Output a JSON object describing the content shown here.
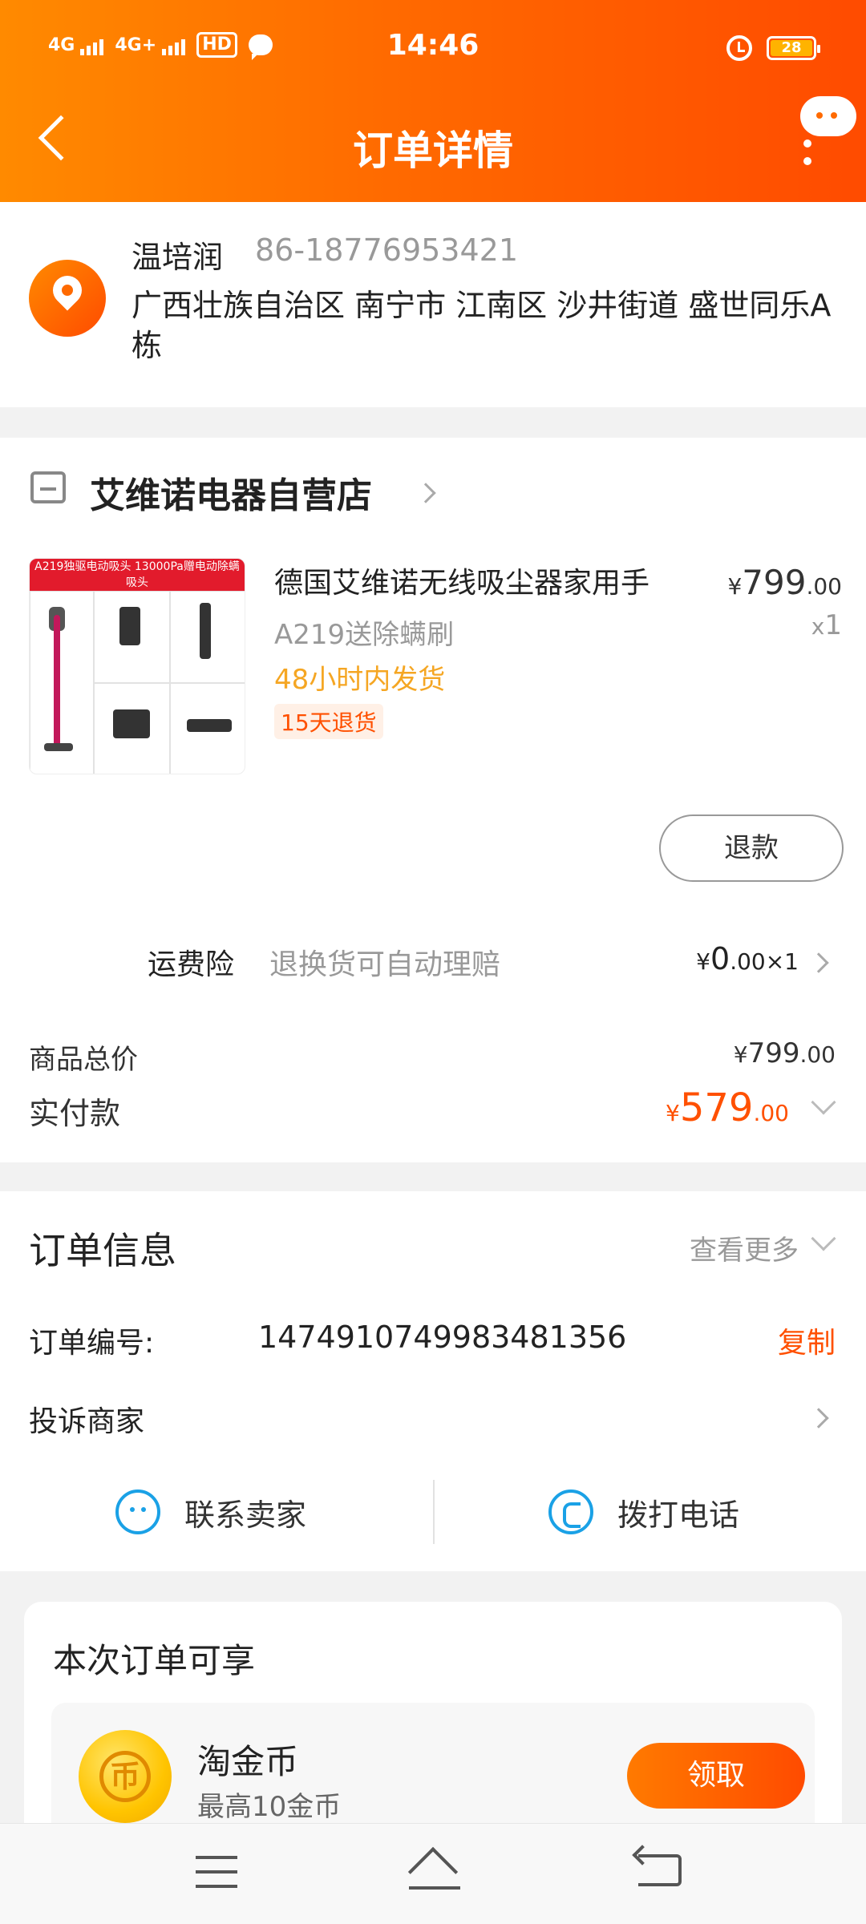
{
  "status_bar": {
    "time": "14:46",
    "signal1": "4G",
    "signal2": "4G+",
    "hd": "HD",
    "battery": "28"
  },
  "header": {
    "title": "订单详情"
  },
  "address": {
    "name": "温培润",
    "phone": "86-18776953421",
    "detail": "广西壮族自治区 南宁市 江南区 沙井街道 盛世同乐A栋"
  },
  "shop": {
    "name": "艾维诺电器自营店"
  },
  "product": {
    "image_banner": "A219独驱电动吸头 13000Pa赠电动除螨吸头",
    "title": "德国艾维诺无线吸尘器家用手",
    "spec": "A219送除螨刷",
    "shipping": "48小时内发货",
    "tag": "15天退货",
    "price_currency": "¥",
    "price_int": "799",
    "price_dec": ".00",
    "qty_prefix": "x",
    "qty": "1"
  },
  "refund_button": "退款",
  "insurance": {
    "label": "运费险",
    "desc": "退换货可自动理赔",
    "currency": "¥",
    "price_int": "0",
    "price_dec": ".00",
    "mult": "×1"
  },
  "totals": {
    "goods_label": "商品总价",
    "goods_currency": "¥",
    "goods_int": "799",
    "goods_dec": ".00",
    "paid_label": "实付款",
    "paid_currency": "¥",
    "paid_int": "579",
    "paid_dec": ".00"
  },
  "order_info": {
    "title": "订单信息",
    "view_more": "查看更多",
    "order_no_label": "订单编号:",
    "order_no": "1474910749983481356",
    "copy": "复制",
    "complain": "投诉商家",
    "contact_seller": "联系卖家",
    "call": "拨打电话"
  },
  "benefit": {
    "title": "本次订单可享",
    "coin_glyph": "币",
    "coin_name": "淘金币",
    "coin_sub": "最高10金币",
    "claim": "领取"
  },
  "colors": {
    "accent": "#ff5000",
    "header_start": "#ff8a00",
    "header_end": "#ff4b00",
    "link_blue": "#1aa1e6",
    "ship_yellow": "#f5a623"
  }
}
